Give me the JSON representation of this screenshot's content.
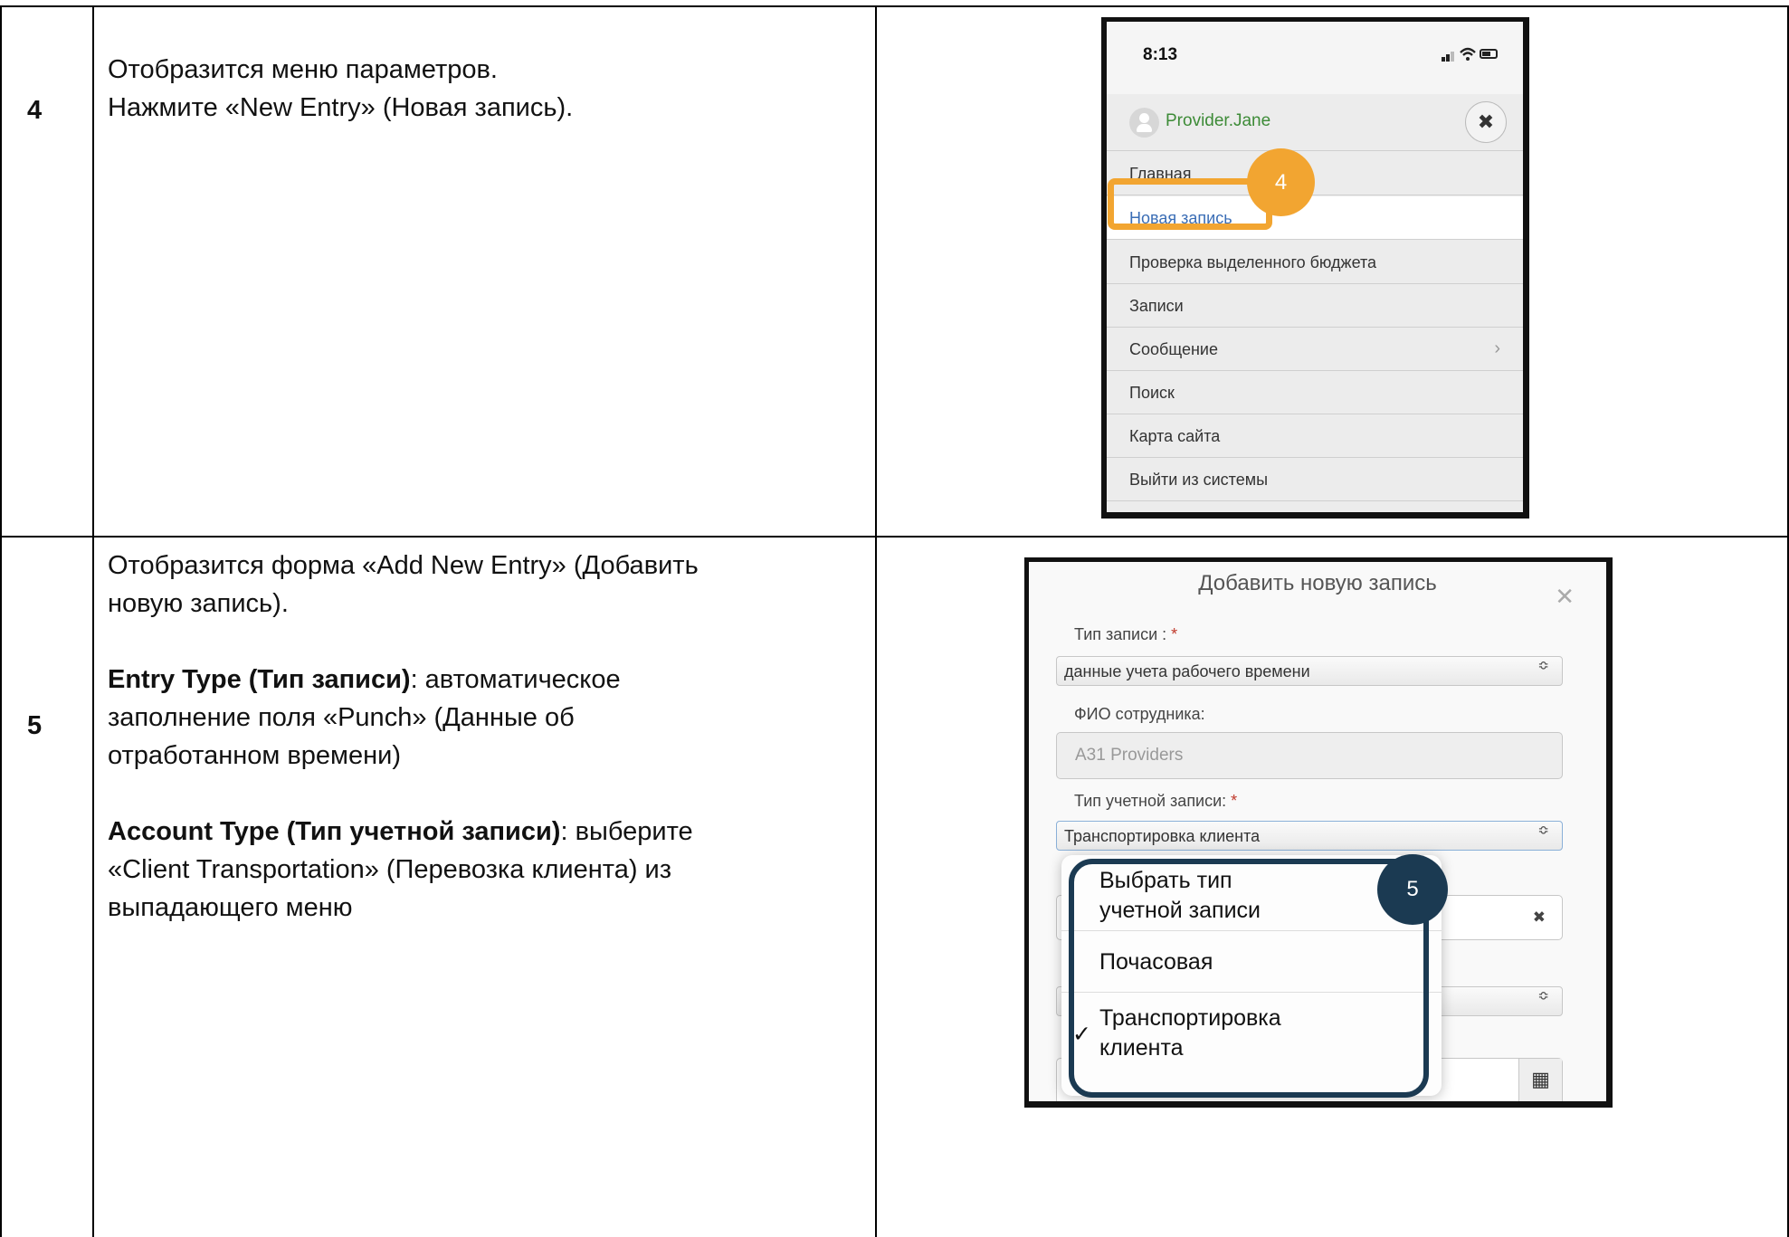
{
  "rows": [
    {
      "step": "4",
      "lines": [
        "Отобразится меню параметров.",
        "Нажмите «New Entry» (Новая запись)."
      ]
    },
    {
      "step": "5",
      "line1": "Отобразится форма «Add New Entry» (Добавить",
      "line2": "новую запись).",
      "entry_type_bold": "Entry Type (Тип записи)",
      "entry_type_rest": ": автоматическое",
      "entry_type_line2": "заполнение поля «Punch» (Данные об",
      "entry_type_line3": "отработанном времени)",
      "account_type_bold": "Account Type (Тип учетной записи)",
      "account_type_rest": ": выберите",
      "account_type_line2": "«Client Transportation» (Перевозка клиента) из",
      "account_type_line3": "выпадающего меню"
    }
  ],
  "phone": {
    "time": "8:13",
    "user": "Provider.Jane",
    "close_glyph": "✖",
    "menu": [
      {
        "label": "Главная"
      },
      {
        "label": "Новая запись"
      },
      {
        "label": "Проверка выделенного бюджета"
      },
      {
        "label": "Записи"
      },
      {
        "label": "Сообщение",
        "chevron": "›"
      },
      {
        "label": "Поиск"
      },
      {
        "label": "Карта сайта"
      },
      {
        "label": "Выйти из системы"
      }
    ],
    "callout": "4",
    "highlight_color": "#f2a531"
  },
  "form": {
    "title": "Добавить новую запись",
    "close_glyph": "✕",
    "entry_type_label": "Тип записи : ",
    "entry_type_value": "данные учета рабочего времени",
    "employee_label": "ФИО сотрудника:",
    "employee_value": "A31 Providers",
    "account_type_label": "Тип учетной записи: ",
    "account_type_value": "Транспортировка клиента",
    "required_mark": "*",
    "updown_glyph": "≎",
    "clear_glyph": "✖",
    "calendar_glyph": "▦",
    "dropdown": [
      {
        "label": "Выбрать тип учетной записи",
        "line1": "Выбрать тип",
        "line2": "учетной записи"
      },
      {
        "label": "Почасовая"
      },
      {
        "label": "Транспортировка клиента",
        "line1": "Транспортировка",
        "line2": "клиента",
        "checked": true
      }
    ],
    "check_glyph": "✓",
    "callout": "5",
    "highlight_color": "#1b3a52"
  }
}
